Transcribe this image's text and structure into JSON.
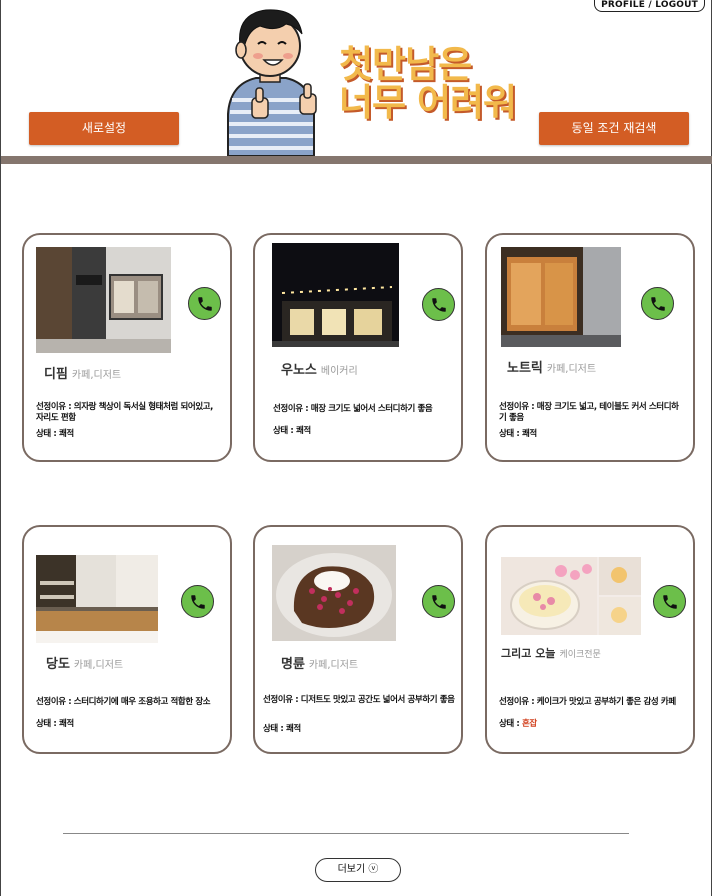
{
  "header": {
    "profile_label": "PROFILE / LOGOUT",
    "reset_button": "새로설정",
    "research_button": "동일 조건 재검색",
    "logo_line1": "첫만남은",
    "logo_line2": "너무 어려워"
  },
  "colors": {
    "accent": "#d35d24",
    "bar": "#85766e",
    "phone": "#6cbf4a",
    "busy": "#d2401e"
  },
  "cards": [
    {
      "name": "디핌",
      "category": "카페,디저트",
      "reason": "선정이유 : 의자랑 책상이 독서실 형태처럼 되어있고, 자리도 편함",
      "status_label": "상태 : ",
      "status_value": "쾌적"
    },
    {
      "name": "우노스",
      "category": "베이커리",
      "reason": "선정이유 : 매장 크기도 넓어서 스터디하기 좋음",
      "status_label": "상태 : ",
      "status_value": "쾌적"
    },
    {
      "name": "노트릭",
      "category": "카페,디저트",
      "reason": "선정이유 : 매장 크기도 넓고, 테이블도 커서 스터디하기 좋음",
      "status_label": "상태 : ",
      "status_value": "쾌적"
    },
    {
      "name": "당도",
      "category": "카페,디저트",
      "reason": "선정이유 : 스터디하기에 매우 조용하고 적합한 장소",
      "status_label": "상태 : ",
      "status_value": "쾌적"
    },
    {
      "name": "명륜",
      "category": "카페,디저트",
      "reason": "선정이유 : 디저트도 맛있고 공간도 넓어서 공부하기 좋음",
      "status_label": "상태 : ",
      "status_value": "쾌적"
    },
    {
      "name": "그리고 오늘",
      "category": "케이크전문",
      "reason": "선정이유 : 케이크가 맛있고 공부하기 좋은 감성 카페",
      "status_label": "상태 : ",
      "status_value": "혼잡"
    }
  ],
  "footer": {
    "more_label": "더보기 ⓥ"
  }
}
